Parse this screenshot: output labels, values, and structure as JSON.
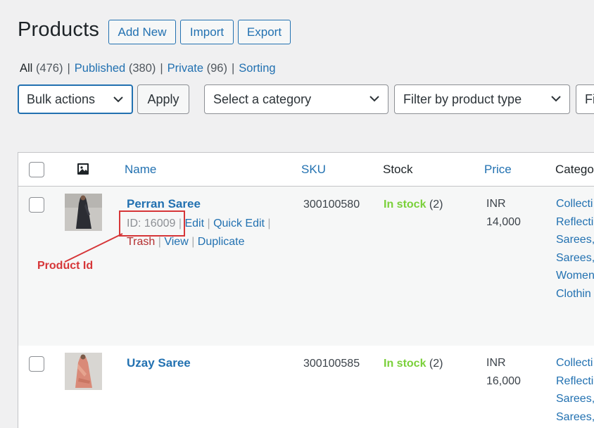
{
  "header": {
    "title": "Products",
    "buttons": {
      "add_new": "Add New",
      "import": "Import",
      "export": "Export"
    }
  },
  "views": [
    {
      "label": "All",
      "count": "(476)"
    },
    {
      "label": "Published",
      "count": "(380)"
    },
    {
      "label": "Private",
      "count": "(96)"
    },
    {
      "label": "Sorting",
      "count": ""
    }
  ],
  "filters": {
    "bulk_actions": "Bulk actions",
    "apply": "Apply",
    "category": "Select a category",
    "product_type": "Filter by product type",
    "truncated_filter": "Fi"
  },
  "table": {
    "columns": {
      "name": "Name",
      "sku": "SKU",
      "stock": "Stock",
      "price": "Price",
      "categories": "Catego"
    },
    "thumb_icon": "image-icon",
    "rows": [
      {
        "name": "Perran Saree",
        "id": "ID: 16009",
        "actions": {
          "edit": "Edit",
          "quick_edit": "Quick Edit",
          "trash": "Trash",
          "view": "View",
          "duplicate": "Duplicate"
        },
        "sku": "300100580",
        "stock": "In stock",
        "stock_qty": "(2)",
        "price_currency": "INR",
        "price_amount": "14,000",
        "categories": [
          "Collecti",
          "Reflecti",
          "Sarees,",
          "Sarees,",
          "Women",
          "Clothin"
        ],
        "thumb_color": "#2b2d33"
      },
      {
        "name": "Uzay Saree",
        "sku": "300100585",
        "stock": "In stock",
        "stock_qty": "(2)",
        "price_currency": "INR",
        "price_amount": "16,000",
        "categories": [
          "Collecti",
          "Reflecti",
          "Sarees,",
          "Sarees,"
        ],
        "thumb_color": "#d98a78"
      }
    ]
  },
  "annotation": {
    "label": "Product Id",
    "color": "#d63638"
  },
  "colors": {
    "link": "#2271b1",
    "in_stock": "#7ad03a",
    "trash": "#b32d2e",
    "background": "#f0f0f1"
  }
}
